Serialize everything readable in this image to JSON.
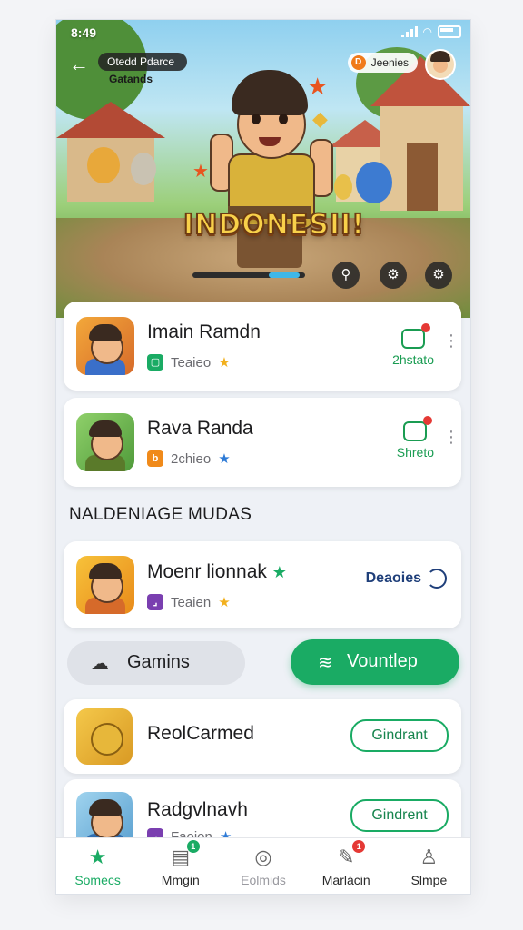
{
  "status_bar": {
    "time": "8:49"
  },
  "hero": {
    "back": "←",
    "chip_label": "Otedd Pdarce",
    "chip_sub": "Gatands",
    "right_chip_label": "Jeenies",
    "right_chip_icon": "D",
    "title": "INDONESII!",
    "progress": 0.95,
    "buttons": [
      "search-icon",
      "gear-icon",
      "settings-icon"
    ]
  },
  "cards": [
    {
      "title": "Imain Ramdn",
      "tag": "Teaieo",
      "action": "2hstato",
      "tag_color": "#1aab64"
    },
    {
      "title": "Rava Randa",
      "tag": "2chieo",
      "action": "Shreto",
      "tag_color": "#f08a1a"
    }
  ],
  "section_title": "NALDENIAGE MUDAS",
  "featured": {
    "title": "Moenr lionnak",
    "tag": "Teaien",
    "status": "Deaoies",
    "tag_color": "#7a3fb0"
  },
  "buttons": {
    "gray": "Gamins",
    "green": "Vountlep"
  },
  "list": [
    {
      "title": "ReolCarmed",
      "action": "Gindrant"
    },
    {
      "title": "Radgvlnavh",
      "action": "Gindrent",
      "tag": "Faoion"
    }
  ],
  "nav": [
    {
      "label": "Somecs",
      "icon": "star-icon",
      "state": "active"
    },
    {
      "label": "Mmgin",
      "icon": "calendar-icon",
      "badge": "1",
      "badge_color": "#1aab64"
    },
    {
      "label": "Eolmids",
      "icon": "globe-icon",
      "state": "muted"
    },
    {
      "label": "Marlácin",
      "icon": "megaphone-icon",
      "badge": "1",
      "badge_color": "#e53935"
    },
    {
      "label": "Slmpe",
      "icon": "user-icon"
    }
  ],
  "colors": {
    "accent": "#1aab64",
    "hero_title": "#f8d14a",
    "dark_text": "#1d1d1f"
  }
}
